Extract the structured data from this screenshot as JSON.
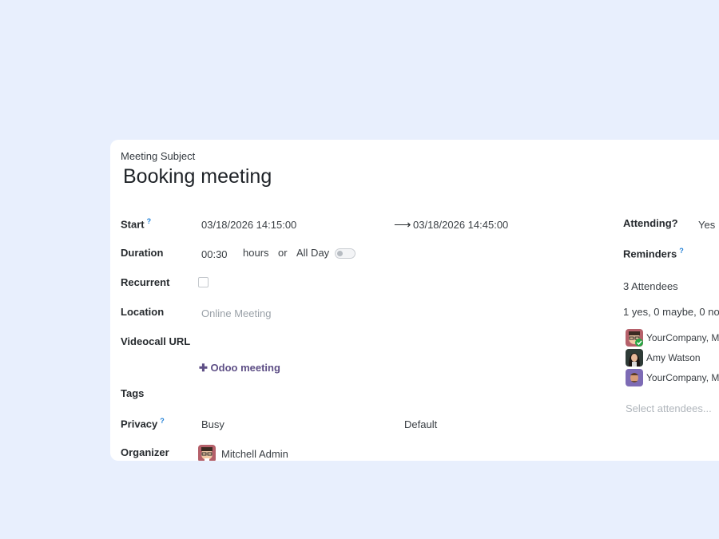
{
  "form": {
    "subject_label": "Meeting Subject",
    "subject_value": "Booking meeting",
    "start": {
      "label": "Start",
      "help": "?",
      "start_value": "03/18/2026 14:15:00",
      "end_value": "03/18/2026 14:45:00"
    },
    "duration": {
      "label": "Duration",
      "value": "00:30",
      "unit": "hours",
      "or_text": "or",
      "allday_label": "All Day"
    },
    "recurrent": {
      "label": "Recurrent",
      "checked": false
    },
    "location": {
      "label": "Location",
      "placeholder": "Online Meeting"
    },
    "videocall": {
      "label": "Videocall URL",
      "add_link": "Odoo meeting"
    },
    "tags": {
      "label": "Tags"
    },
    "privacy": {
      "label": "Privacy",
      "help": "?",
      "value": "Busy",
      "show_as": "Default"
    },
    "organizer": {
      "label": "Organizer",
      "value": "Mitchell Admin"
    }
  },
  "side": {
    "attending": {
      "label": "Attending?",
      "value": "Yes"
    },
    "reminders": {
      "label": "Reminders",
      "help": "?"
    },
    "attendees_count": "3 Attendees",
    "attendees_summary": "1 yes, 0 maybe, 0 no",
    "attendees": [
      {
        "name": "YourCompany, M",
        "status": "accepted"
      },
      {
        "name": "Amy Watson"
      },
      {
        "name": "YourCompany, M"
      }
    ],
    "select_placeholder": "Select attendees..."
  },
  "colors": {
    "background": "#e8effd",
    "accent": "#5e4f86",
    "help": "#1f7fd6",
    "accepted": "#28a745"
  }
}
